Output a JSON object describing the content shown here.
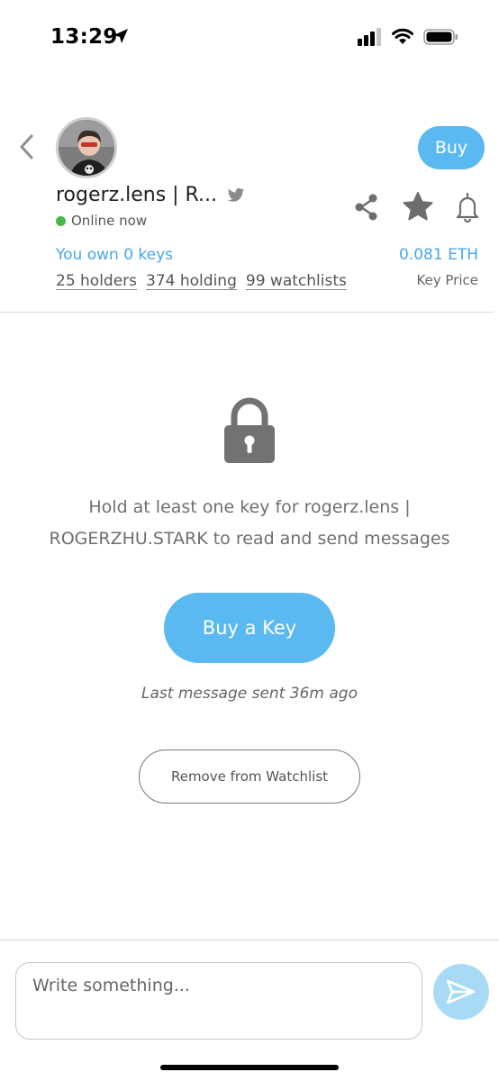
{
  "status_bar": {
    "time": "13:29"
  },
  "header": {
    "buy_label": "Buy",
    "profile_name": "rogerz.lens | R...",
    "online_status": "Online now",
    "own_keys": "You own 0 keys",
    "stats": {
      "holders": "25 holders",
      "holding": "374 holding",
      "watchlists": "99 watchlists"
    },
    "key_price_value": "0.081 ETH",
    "key_price_label": "Key Price",
    "icons": [
      "back-chevron-icon",
      "twitter-icon",
      "share-icon",
      "star-icon",
      "bell-icon"
    ]
  },
  "main": {
    "lock_icon": "lock-icon",
    "hold_message": "Hold at least one key for rogerz.lens | ROGERZHU.STARK to read and send messages",
    "buy_key_label": "Buy a Key",
    "last_message": "Last message sent 36m ago",
    "watchlist_label": "Remove from Watchlist"
  },
  "composer": {
    "placeholder": "Write something...",
    "send_icon": "send-icon"
  },
  "colors": {
    "accent": "#5ab9f0",
    "link": "#46a7e6",
    "online": "#49b748",
    "send_button": "#a8daf6"
  }
}
